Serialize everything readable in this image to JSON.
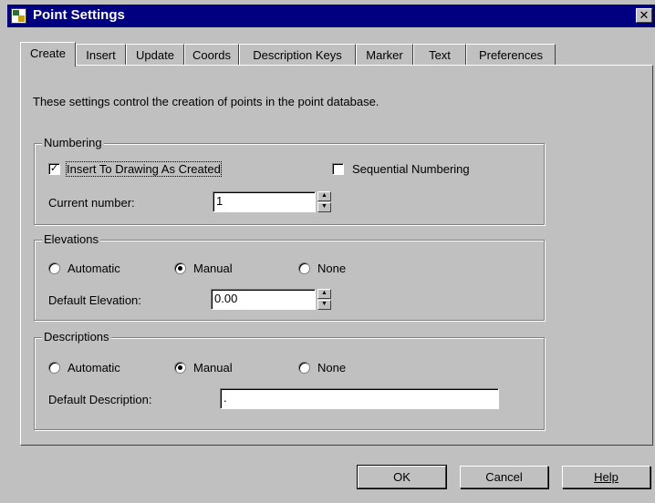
{
  "window": {
    "title": "Point Settings",
    "close_glyph": "✕"
  },
  "tabs": [
    {
      "label": "Create",
      "active": true
    },
    {
      "label": "Insert"
    },
    {
      "label": "Update"
    },
    {
      "label": "Coords"
    },
    {
      "label": "Description Keys"
    },
    {
      "label": "Marker"
    },
    {
      "label": "Text"
    },
    {
      "label": "Preferences"
    }
  ],
  "intro": "These settings control the creation of points in the point database.",
  "numbering": {
    "label": "Numbering",
    "insert_checkbox": {
      "label": "Insert To Drawing As Created",
      "checked": true,
      "mark": "✓"
    },
    "sequential_checkbox": {
      "label": "Sequential Numbering",
      "checked": false
    },
    "current_number_label": "Current number:",
    "current_number_value": "1"
  },
  "elevations": {
    "label": "Elevations",
    "options": [
      "Automatic",
      "Manual",
      "None"
    ],
    "selected": "Manual",
    "default_label": "Default Elevation:",
    "default_value": "0.00"
  },
  "descriptions": {
    "label": "Descriptions",
    "options": [
      "Automatic",
      "Manual",
      "None"
    ],
    "selected": "Manual",
    "default_label": "Default Description:",
    "default_value": "."
  },
  "buttons": {
    "ok": "OK",
    "cancel": "Cancel",
    "help": "Help"
  },
  "icons": {
    "spin_up": "▲",
    "spin_down": "▼"
  }
}
